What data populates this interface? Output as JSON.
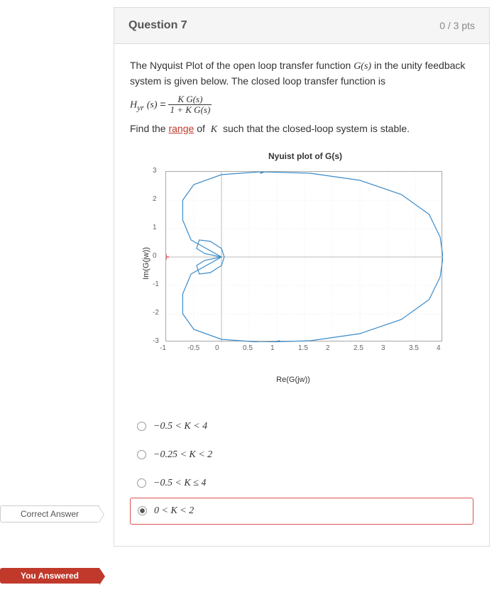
{
  "header": {
    "title": "Question 7",
    "points": "0 / 3 pts"
  },
  "prompt": {
    "line1_pre": "The Nyquist Plot of the open loop transfer function ",
    "line1_gs": "G(s)",
    "line1_post": " in the unity feedback system is given below. The closed loop transfer function is",
    "eq_left": "H",
    "eq_sub": "yr",
    "eq_arg": "(s)",
    "eq_eq": " = ",
    "frac_num": "K G(s)",
    "frac_den": "1 + K G(s)",
    "line3_pre": "Find the ",
    "line3_link": "range",
    "line3_mid": " of ",
    "line3_k": "K",
    "line3_post": " such that the closed-loop system is stable."
  },
  "chart_data": {
    "type": "line",
    "title": "Nyuist plot of G(s)",
    "xlabel": "Re(G(jw))",
    "ylabel": "Im(G(jw))",
    "xlim": [
      -1,
      4
    ],
    "ylim": [
      -3,
      3
    ],
    "xticks": [
      -1,
      -0.5,
      0,
      0.5,
      1,
      1.5,
      2,
      2.5,
      3,
      3.5,
      4
    ],
    "yticks": [
      -3,
      -2,
      -1,
      0,
      1,
      2,
      3
    ],
    "critical_point": {
      "x": -1,
      "y": 0
    },
    "series": [
      {
        "name": "nyquist-contour",
        "closed": true,
        "points": [
          [
            0,
            0
          ],
          [
            -0.3,
            0.12
          ],
          [
            -0.45,
            0.3
          ],
          [
            -0.4,
            0.6
          ],
          [
            -0.2,
            0.55
          ],
          [
            0,
            0.3
          ],
          [
            0.05,
            0
          ],
          [
            0,
            -0.3
          ],
          [
            -0.2,
            -0.55
          ],
          [
            -0.4,
            -0.6
          ],
          [
            -0.45,
            -0.3
          ],
          [
            -0.3,
            -0.12
          ],
          [
            0,
            0
          ],
          [
            -0.55,
            0.6
          ],
          [
            -0.7,
            1.3
          ],
          [
            -0.7,
            2.0
          ],
          [
            -0.5,
            2.55
          ],
          [
            0,
            2.9
          ],
          [
            0.7,
            3.0
          ],
          [
            1.6,
            2.95
          ],
          [
            2.5,
            2.7
          ],
          [
            3.25,
            2.2
          ],
          [
            3.75,
            1.5
          ],
          [
            3.95,
            0.7
          ],
          [
            4.0,
            0
          ],
          [
            3.95,
            -0.7
          ],
          [
            3.75,
            -1.5
          ],
          [
            3.25,
            -2.2
          ],
          [
            2.5,
            -2.7
          ],
          [
            1.6,
            -2.95
          ],
          [
            0.7,
            -3.0
          ],
          [
            0,
            -2.9
          ],
          [
            -0.5,
            -2.55
          ],
          [
            -0.7,
            -2.0
          ],
          [
            -0.7,
            -1.3
          ],
          [
            -0.55,
            -0.6
          ],
          [
            0,
            0
          ]
        ]
      }
    ]
  },
  "options": [
    {
      "label": "−0.5 < K < 4",
      "checked": false,
      "correct": false
    },
    {
      "label": "−0.25 < K < 2",
      "checked": false,
      "correct": true
    },
    {
      "label": "−0.5 < K ≤ 4",
      "checked": false,
      "correct": false
    },
    {
      "label": "0 < K < 2",
      "checked": true,
      "correct": false
    }
  ],
  "tags": {
    "correct": "Correct Answer",
    "answered": "You Answered"
  }
}
